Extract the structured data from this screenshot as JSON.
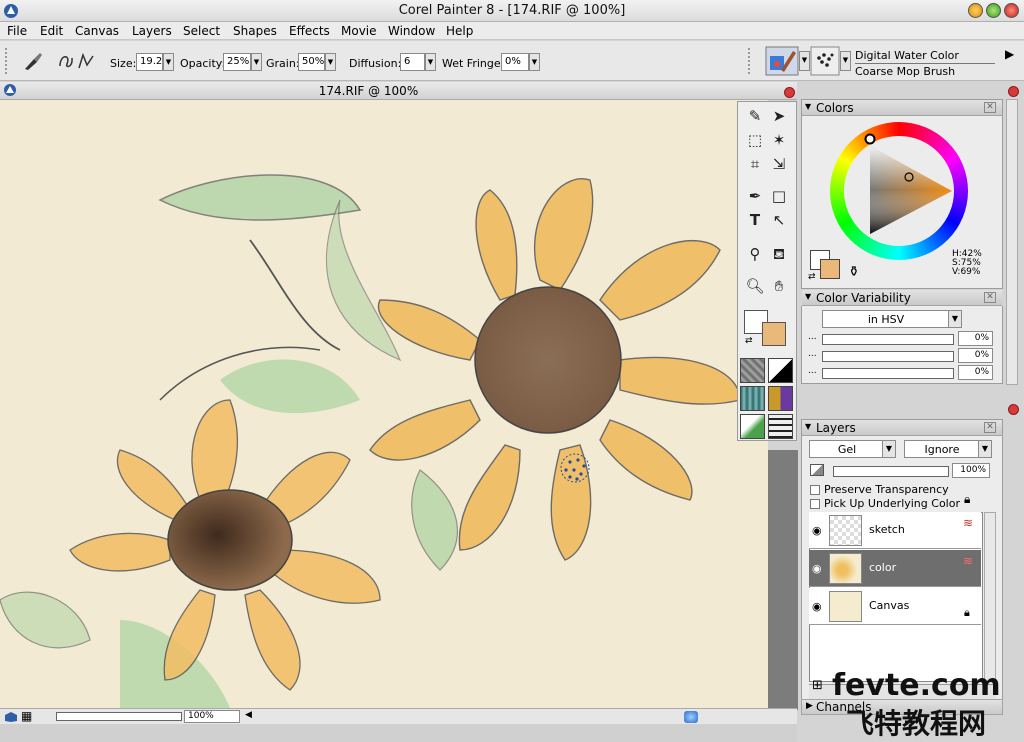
{
  "window": {
    "title": "Corel Painter 8 - [174.RIF @ 100%]"
  },
  "menu": [
    "File",
    "Edit",
    "Canvas",
    "Layers",
    "Select",
    "Shapes",
    "Effects",
    "Movie",
    "Window",
    "Help"
  ],
  "propbar": {
    "size_label": "Size:",
    "size_value": "19.2",
    "opacity_label": "Opacity:",
    "opacity_value": "25%",
    "grain_label": "Grain:",
    "grain_value": "50%",
    "diffusion_label": "Diffusion:",
    "diffusion_value": "6",
    "wet_label": "Wet Fringe:",
    "wet_value": "0%",
    "brush_category": "Digital Water Color",
    "brush_variant": "Coarse Mop Brush"
  },
  "document": {
    "title": "174.RIF @ 100%",
    "zoom": "100%"
  },
  "colors": {
    "title": "Colors",
    "h": "H:42%",
    "s": "S:75%",
    "v": "V:69%",
    "main_color": "#eab87a",
    "additional_color": "#ffffff"
  },
  "variability": {
    "title": "Color Variability",
    "mode": "in HSV",
    "values": [
      "0%",
      "0%",
      "0%"
    ]
  },
  "layers": {
    "title": "Layers",
    "composite_method": "Gel",
    "composite_depth": "Ignore",
    "opacity": "100%",
    "preserve_transparency": "Preserve Transparency",
    "pick_up_color": "Pick Up Underlying Color",
    "items": [
      {
        "name": "sketch",
        "selected": false
      },
      {
        "name": "color",
        "selected": true
      },
      {
        "name": "Canvas",
        "selected": false
      }
    ]
  },
  "channels": {
    "title": "Channels"
  },
  "watermark": {
    "line1": "fevte.com",
    "line2": "飞特教程网"
  }
}
